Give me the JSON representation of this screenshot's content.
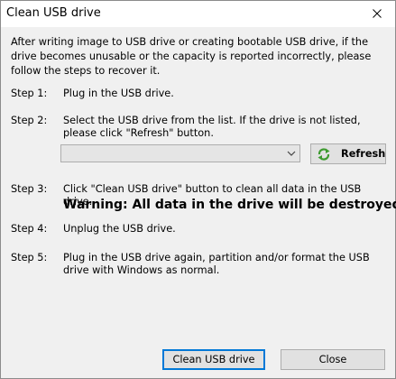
{
  "window": {
    "title": "Clean USB drive"
  },
  "intro": "After writing image to USB drive or creating bootable USB drive, if the drive becomes unusable or the capacity is reported incorrectly, please follow the steps to recover it.",
  "steps": [
    {
      "label": "Step 1:",
      "text": "Plug in the USB drive."
    },
    {
      "label": "Step 2:",
      "text": "Select the USB drive from the list. If the drive is not listed, please click \"Refresh\" button."
    },
    {
      "label": "Step 3:",
      "text": "Click \"Clean USB drive\" button to clean all data in the USB drive."
    },
    {
      "label": "Step 4:",
      "text": "Unplug the USB drive."
    },
    {
      "label": "Step 5:",
      "text": "Plug in the USB drive again, partition and/or format the USB drive with Windows as normal."
    }
  ],
  "warning": "Warning: All data in the drive will be destroyed.",
  "drive_select": {
    "value": ""
  },
  "buttons": {
    "refresh": "Refresh",
    "clean": "Clean USB drive",
    "close": "Close"
  },
  "icons": {
    "close": "close-icon",
    "refresh": "refresh-icon",
    "dropdown": "chevron-down-icon"
  },
  "colors": {
    "dialog_bg": "#f0f0f0",
    "button_bg": "#e1e1e1",
    "default_button_border": "#0078d7",
    "refresh_icon": "#3c9a2e"
  }
}
